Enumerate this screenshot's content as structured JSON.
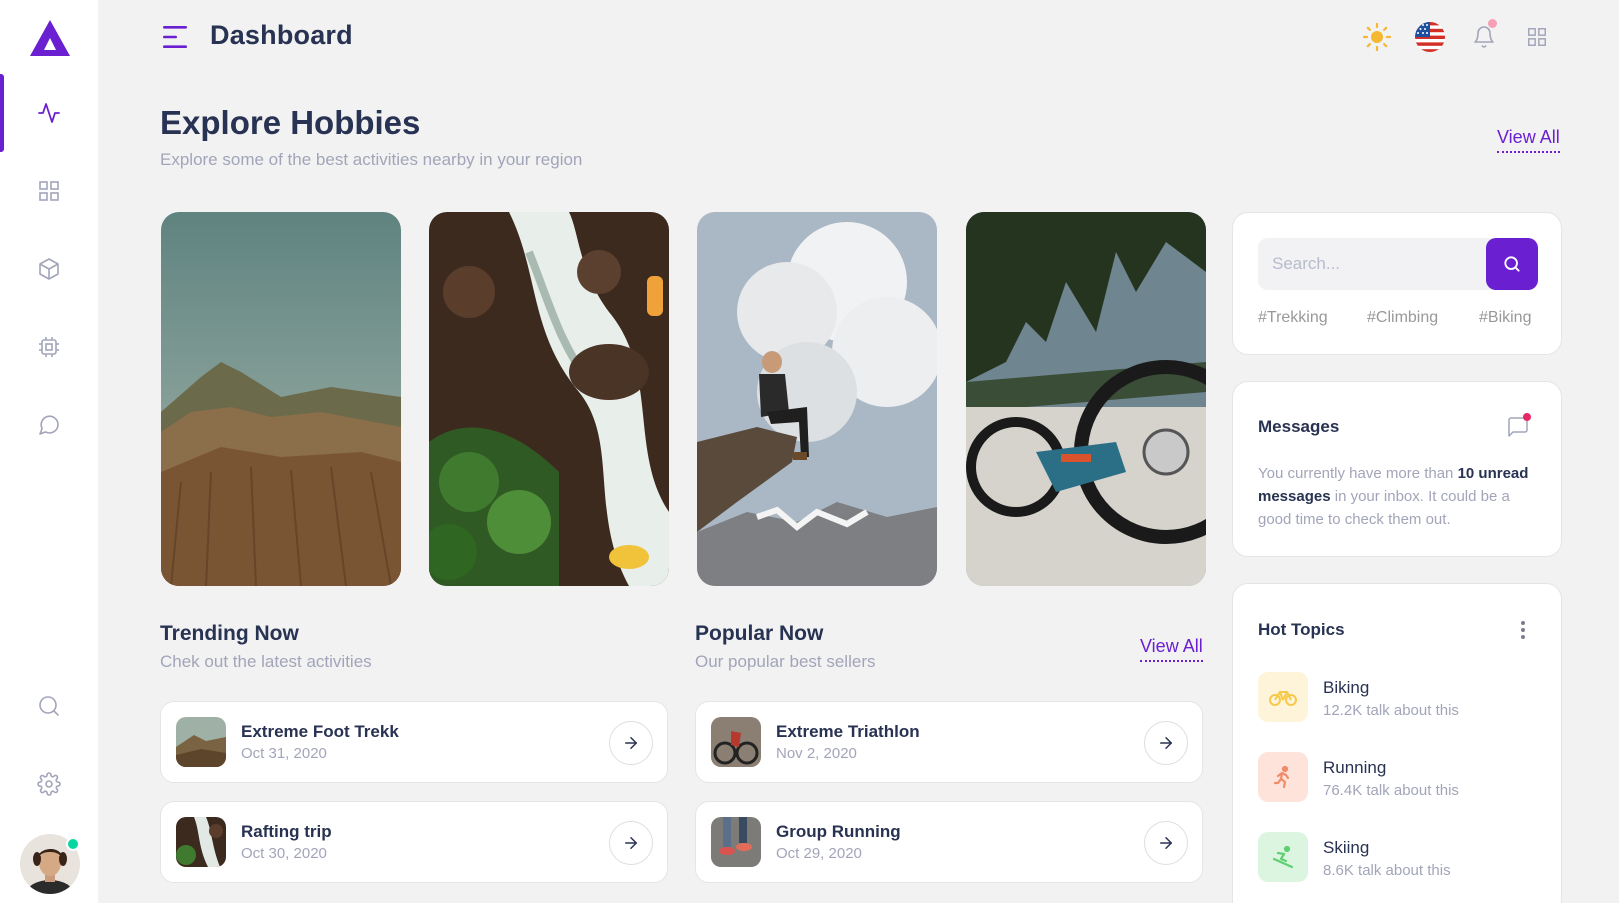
{
  "header": {
    "title": "Dashboard"
  },
  "sidebar": {
    "items": [
      {
        "icon": "activity-icon",
        "active": true
      },
      {
        "icon": "grid-icon",
        "active": false
      },
      {
        "icon": "box-icon",
        "active": false
      },
      {
        "icon": "cpu-icon",
        "active": false
      },
      {
        "icon": "message-circle-icon",
        "active": false
      },
      {
        "icon": "search-icon",
        "active": false
      },
      {
        "icon": "settings-icon",
        "active": false
      }
    ],
    "user_status": "online"
  },
  "explore": {
    "title": "Explore Hobbies",
    "subtitle": "Explore some of the best activities nearby in your region",
    "view_all": "View All"
  },
  "trending": {
    "title": "Trending Now",
    "subtitle": "Chek out the latest activities",
    "items": [
      {
        "name": "Extreme Foot Trekk",
        "date": "Oct 31, 2020"
      },
      {
        "name": "Rafting trip",
        "date": "Oct 30, 2020"
      }
    ]
  },
  "popular": {
    "title": "Popular Now",
    "subtitle": "Our popular best sellers",
    "view_all": "View All",
    "items": [
      {
        "name": "Extreme Triathlon",
        "date": "Nov 2, 2020"
      },
      {
        "name": "Group Running",
        "date": "Oct 29, 2020"
      }
    ]
  },
  "search": {
    "placeholder": "Search...",
    "tags": [
      "#Trekking",
      "#Climbing",
      "#Biking"
    ]
  },
  "messages": {
    "title": "Messages",
    "text_before": "You currently have more than ",
    "text_bold": "10 unread messages",
    "text_after": " in your inbox. It could be a good time to check them out."
  },
  "hot_topics": {
    "title": "Hot Topics",
    "items": [
      {
        "name": "Biking",
        "count": "12.2K talk about this",
        "color": "#f7c948"
      },
      {
        "name": "Running",
        "count": "76.4K talk about this",
        "color": "#f28b69"
      },
      {
        "name": "Skiing",
        "count": "8.6K talk about this",
        "color": "#5fcf73"
      }
    ]
  },
  "colors": {
    "accent": "#6a1fd0",
    "text": "#283252",
    "muted": "#a2a5b9",
    "online": "#06d6a0"
  }
}
